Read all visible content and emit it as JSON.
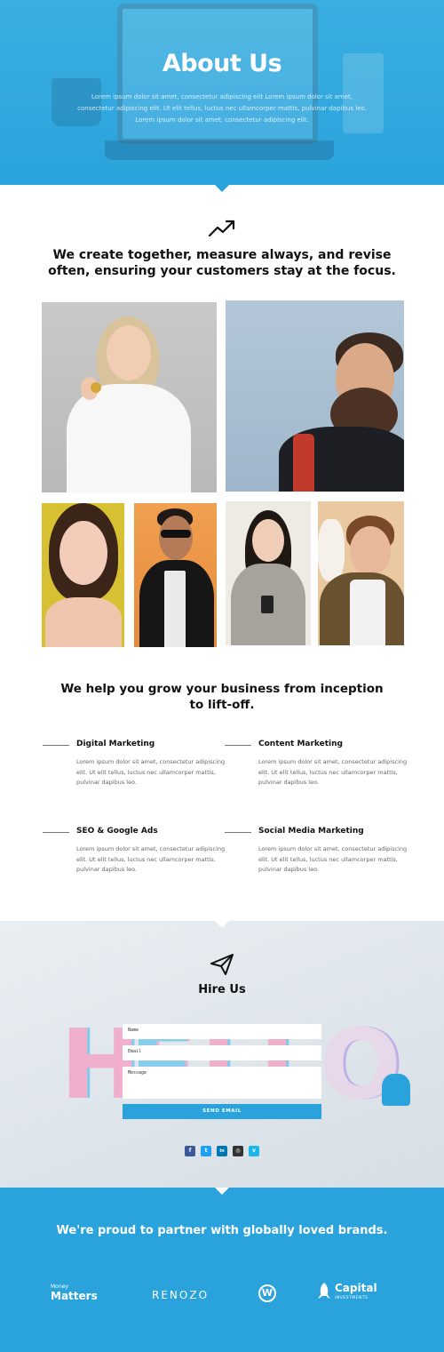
{
  "hero": {
    "title": "About Us",
    "text": "Lorem ipsum dolor sit amet, consectetur adipiscing elit Lorem ipsum dolor sit amet, consectetur adipiscing elit. Ut elit tellus, luctus nec ullamcorper mattis, pulvinar dapibus leo. Lorem ipsum dolor sit amet, consectetur adipiscing elit."
  },
  "mission": {
    "icon": "trending-up-icon",
    "heading": "We create together, measure always, and revise often, ensuring your customers stay at the focus."
  },
  "team_photos": [
    {
      "name": "woman-holding-coin"
    },
    {
      "name": "bearded-man"
    },
    {
      "name": "woman-yellow-background"
    },
    {
      "name": "man-sunglasses"
    },
    {
      "name": "woman-with-phone"
    },
    {
      "name": "man-with-hat"
    }
  ],
  "services": {
    "heading": "We help you grow your business from inception to lift-off.",
    "items": [
      {
        "title": "Digital Marketing",
        "text": "Lorem ipsum dolor sit amet, consectetur adipiscing elit. Ut elit tellus, luctus nec ullamcorper mattis, pulvinar dapibus leo."
      },
      {
        "title": "Content Marketing",
        "text": "Lorem ipsum dolor sit amet, consectetur adipiscing elit. Ut elit tellus, luctus nec ullamcorper mattis, pulvinar dapibus leo."
      },
      {
        "title": "SEO & Google Ads",
        "text": "Lorem ipsum dolor sit amet, consectetur adipiscing elit. Ut elit tellus, luctus nec ullamcorper mattis, pulvinar dapibus leo."
      },
      {
        "title": "Social Media Marketing",
        "text": "Lorem ipsum dolor sit amet, consectetur adipiscing elit. Ut elit tellus, luctus nec ullamcorper mattis, pulvinar dapibus leo."
      }
    ]
  },
  "hire": {
    "icon": "paper-plane-icon",
    "heading": "Hire Us",
    "name_placeholder": "Name",
    "email_placeholder": "Email",
    "message_placeholder": "Message",
    "send_label": "SEND EMAIL",
    "social": [
      {
        "icon": "facebook-icon",
        "glyph": "f",
        "color": "#3b5998"
      },
      {
        "icon": "twitter-icon",
        "glyph": "t",
        "color": "#1da1f2"
      },
      {
        "icon": "linkedin-icon",
        "glyph": "in",
        "color": "#0077b5"
      },
      {
        "icon": "instagram-icon",
        "glyph": "◎",
        "color": "#333333"
      },
      {
        "icon": "vimeo-icon",
        "glyph": "v",
        "color": "#1ab7ea"
      }
    ]
  },
  "partners": {
    "heading": "We're proud to partner with globally loved brands.",
    "logos": {
      "money_small": "Money",
      "money_big": "Matters",
      "renozo": "RENOZO",
      "wordpress": "W",
      "capital_big": "Capital",
      "capital_small": "INVESTMENTS"
    }
  },
  "colors": {
    "accent": "#2aa3dc",
    "text_dark": "#111111",
    "text_muted": "#666666"
  }
}
